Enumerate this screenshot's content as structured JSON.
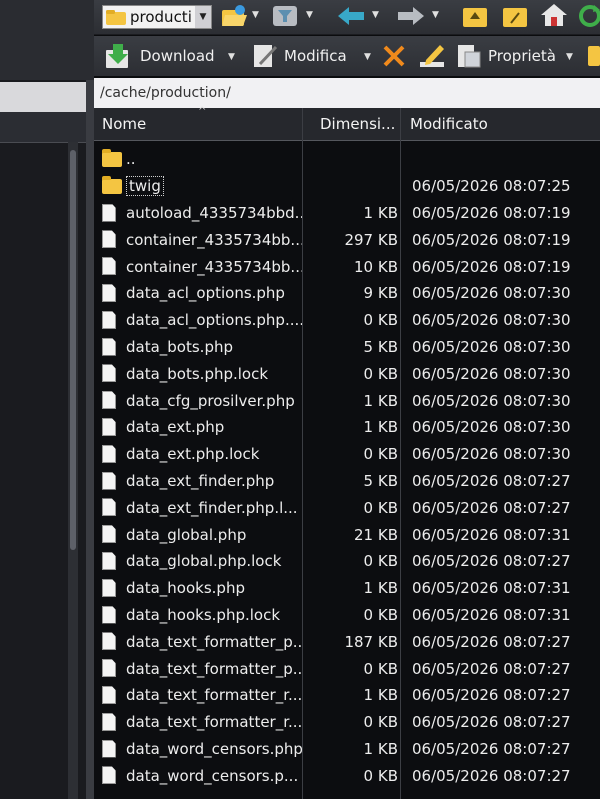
{
  "toolbar": {
    "folder_combo_value": "producti",
    "download_label": "Download",
    "modifica_label": "Modifica",
    "proprieta_label": "Proprietà"
  },
  "path": "/cache/production/",
  "columns": {
    "name": "Nome",
    "size": "Dimensi...",
    "date": "Modificato"
  },
  "files": [
    {
      "type": "up",
      "name": "..",
      "size": "",
      "date": ""
    },
    {
      "type": "folder",
      "name": "twig",
      "size": "",
      "date": "06/05/2026 08:07:25"
    },
    {
      "type": "file",
      "name": "autoload_4335734bbd...",
      "size": "1 KB",
      "date": "06/05/2026 08:07:19"
    },
    {
      "type": "file",
      "name": "container_4335734bb...",
      "size": "297 KB",
      "date": "06/05/2026 08:07:19"
    },
    {
      "type": "file",
      "name": "container_4335734bb...",
      "size": "10 KB",
      "date": "06/05/2026 08:07:19"
    },
    {
      "type": "file",
      "name": "data_acl_options.php",
      "size": "9 KB",
      "date": "06/05/2026 08:07:30"
    },
    {
      "type": "file",
      "name": "data_acl_options.php....",
      "size": "0 KB",
      "date": "06/05/2026 08:07:30"
    },
    {
      "type": "file",
      "name": "data_bots.php",
      "size": "5 KB",
      "date": "06/05/2026 08:07:30"
    },
    {
      "type": "file",
      "name": "data_bots.php.lock",
      "size": "0 KB",
      "date": "06/05/2026 08:07:30"
    },
    {
      "type": "file",
      "name": "data_cfg_prosilver.php",
      "size": "1 KB",
      "date": "06/05/2026 08:07:30"
    },
    {
      "type": "file",
      "name": "data_ext.php",
      "size": "1 KB",
      "date": "06/05/2026 08:07:30"
    },
    {
      "type": "file",
      "name": "data_ext.php.lock",
      "size": "0 KB",
      "date": "06/05/2026 08:07:30"
    },
    {
      "type": "file",
      "name": "data_ext_finder.php",
      "size": "5 KB",
      "date": "06/05/2026 08:07:27"
    },
    {
      "type": "file",
      "name": "data_ext_finder.php.l...",
      "size": "0 KB",
      "date": "06/05/2026 08:07:27"
    },
    {
      "type": "file",
      "name": "data_global.php",
      "size": "21 KB",
      "date": "06/05/2026 08:07:31"
    },
    {
      "type": "file",
      "name": "data_global.php.lock",
      "size": "0 KB",
      "date": "06/05/2026 08:07:27"
    },
    {
      "type": "file",
      "name": "data_hooks.php",
      "size": "1 KB",
      "date": "06/05/2026 08:07:31"
    },
    {
      "type": "file",
      "name": "data_hooks.php.lock",
      "size": "0 KB",
      "date": "06/05/2026 08:07:31"
    },
    {
      "type": "file",
      "name": "data_text_formatter_p...",
      "size": "187 KB",
      "date": "06/05/2026 08:07:27"
    },
    {
      "type": "file",
      "name": "data_text_formatter_p...",
      "size": "0 KB",
      "date": "06/05/2026 08:07:27"
    },
    {
      "type": "file",
      "name": "data_text_formatter_r...",
      "size": "1 KB",
      "date": "06/05/2026 08:07:27"
    },
    {
      "type": "file",
      "name": "data_text_formatter_r...",
      "size": "0 KB",
      "date": "06/05/2026 08:07:27"
    },
    {
      "type": "file",
      "name": "data_word_censors.php",
      "size": "1 KB",
      "date": "06/05/2026 08:07:27"
    },
    {
      "type": "file",
      "name": "data_word_censors.p...",
      "size": "0 KB",
      "date": "06/05/2026 08:07:27"
    }
  ],
  "colors": {
    "folder": "#f4c542",
    "toolbar_bg": "#33363b",
    "list_bg": "#0c0d10",
    "path_bar_bg": "#f1f1f3",
    "delete_x": "#f08a1c"
  }
}
